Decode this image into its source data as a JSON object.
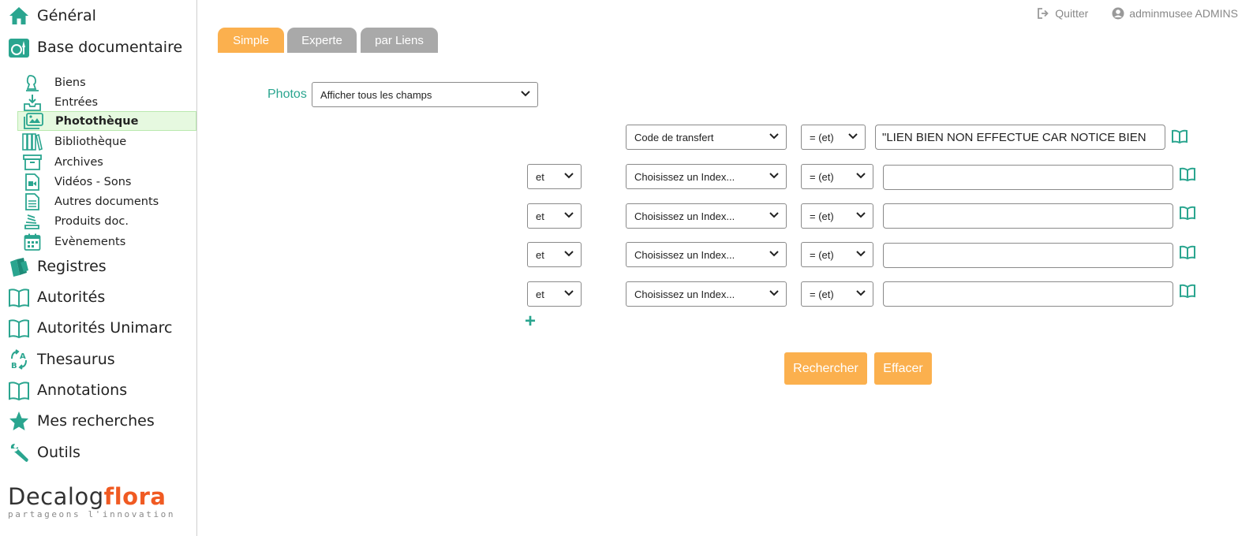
{
  "topbar": {
    "quit_label": "Quitter",
    "user_label": "adminmusee ADMINS"
  },
  "sidebar": {
    "general": "Général",
    "base_documentaire": "Base documentaire",
    "sub_items": [
      "Biens",
      "Entrées",
      "Photothèque",
      "Bibliothèque",
      "Archives",
      "Vidéos - Sons",
      "Autres documents",
      "Produits doc.",
      "Evènements"
    ],
    "registres": "Registres",
    "autorites": "Autorités",
    "autorites_unimarc": "Autorités Unimarc",
    "thesaurus": "Thesaurus",
    "annotations": "Annotations",
    "mes_recherches": "Mes recherches",
    "outils": "Outils"
  },
  "logo": {
    "word1": "Decalog",
    "word2": "flora",
    "tagline": "partageons l'innovation"
  },
  "tabs": [
    "Simple",
    "Experte",
    "par Liens"
  ],
  "photos": {
    "label": "Photos",
    "select_value": "Afficher tous les champs"
  },
  "criteria": [
    {
      "field": "Code de transfert",
      "operator": "= (et)",
      "value": "\"LIEN BIEN NON EFFECTUE CAR NOTICE BIEN"
    },
    {
      "connector": "et",
      "field": "Choisissez un Index...",
      "operator": "= (et)",
      "value": ""
    },
    {
      "connector": "et",
      "field": "Choisissez un Index...",
      "operator": "= (et)",
      "value": ""
    },
    {
      "connector": "et",
      "field": "Choisissez un Index...",
      "operator": "= (et)",
      "value": ""
    },
    {
      "connector": "et",
      "field": "Choisissez un Index...",
      "operator": "= (et)",
      "value": ""
    }
  ],
  "add_symbol": "+",
  "buttons": {
    "search": "Rechercher",
    "clear": "Effacer"
  },
  "colors": {
    "accent_teal": "#2aa58f",
    "accent_orange": "#fbb04e",
    "tab_inactive": "#a9a9a9",
    "active_bg": "#e6f9e0",
    "logo_orange": "#f05a22"
  }
}
